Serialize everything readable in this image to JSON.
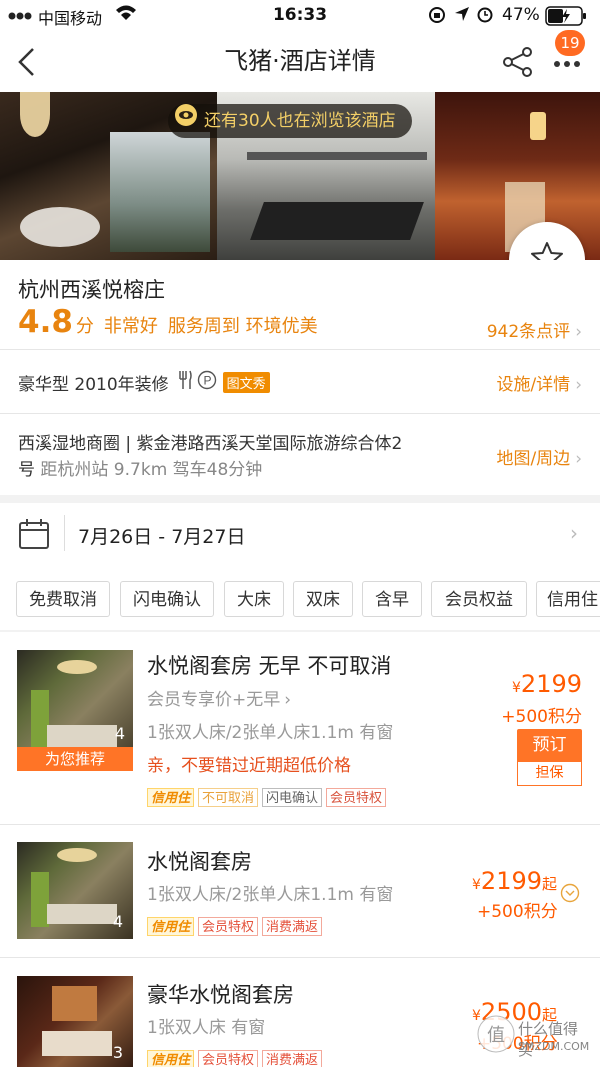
{
  "status_bar": {
    "carrier": "中国移动",
    "time": "16:33",
    "battery": "47%"
  },
  "nav": {
    "title": "飞猪·酒店详情",
    "badge_count": "19"
  },
  "photos": {
    "browse_banner": "还有30人也在浏览该酒店"
  },
  "hotel": {
    "name": "杭州西溪悦榕庄",
    "score": "4.8",
    "score_unit": "分",
    "score_desc": "非常好",
    "highlights": "服务周到 环境优美",
    "review_count": "942条点评"
  },
  "facility": {
    "text": "豪华型 2010年装修",
    "badge": "图文秀",
    "link": "设施/详情"
  },
  "location": {
    "line1": "西溪湿地商圈 | 紫金港路西溪天堂国际旅游综合体2",
    "line2_prefix": "号",
    "line2_distance": "距杭州站 9.7km 驾车48分钟",
    "link": "地图/周边"
  },
  "dates": {
    "range": "7月26日 - 7月27日"
  },
  "filters": [
    "免费取消",
    "闪电确认",
    "大床",
    "双床",
    "含早",
    "会员权益",
    "信用住"
  ],
  "rooms": [
    {
      "name": "水悦阁套房 无早 不可取消",
      "member_line": "会员专享价+无早",
      "beds": "1张双人床/2张单人床1.1m 有窗",
      "promo": "亲，不要错过近期超低价格",
      "photo_count": "4",
      "recommend": "为您推荐",
      "price": "2199",
      "currency": "¥",
      "points": "+500积分",
      "book_label": "预订",
      "guarantee_label": "担保",
      "tags": [
        {
          "text": "信用住",
          "style": "credit"
        },
        {
          "text": "不可取消",
          "style": "cancel"
        },
        {
          "text": "闪电确认",
          "style": "gray"
        },
        {
          "text": "会员特权",
          "style": "member"
        }
      ]
    },
    {
      "name": "水悦阁套房",
      "beds": "1张双人床/2张单人床1.1m 有窗",
      "photo_count": "4",
      "price": "2199",
      "currency": "¥",
      "price_suffix": "起",
      "points": "+500积分",
      "tags": [
        {
          "text": "信用住",
          "style": "credit"
        },
        {
          "text": "会员特权",
          "style": "red"
        },
        {
          "text": "消费满返",
          "style": "red"
        }
      ]
    },
    {
      "name": "豪华水悦阁套房",
      "beds": "1张双人床 有窗",
      "photo_count": "3",
      "price": "2500",
      "currency": "¥",
      "price_suffix": "起",
      "points": "+500积分",
      "tags": [
        {
          "text": "信用住",
          "style": "credit"
        },
        {
          "text": "会员特权",
          "style": "red"
        },
        {
          "text": "消费满返",
          "style": "red"
        }
      ]
    }
  ],
  "watermark": {
    "line1": "什么值得买",
    "line2": "SMZDM.COM"
  },
  "colors": {
    "accent_orange": "#e8840f",
    "price_orange": "#ff5a00",
    "badge": "#ff6a22",
    "recommend": "#ff7426"
  }
}
